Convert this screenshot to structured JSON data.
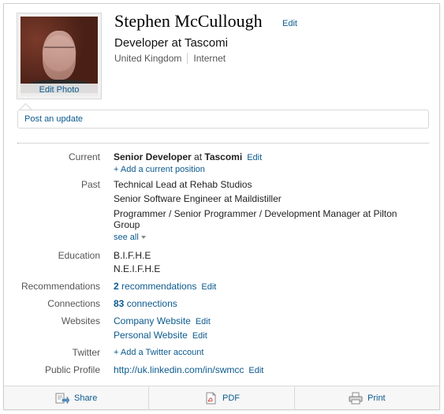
{
  "profile": {
    "name": "Stephen McCullough",
    "name_edit": "Edit",
    "edit_photo": "Edit Photo",
    "headline": "Developer at Tascomi",
    "location": "United Kingdom",
    "industry": "Internet",
    "post_update": "Post an update"
  },
  "current": {
    "label": "Current",
    "title": "Senior Developer",
    "at": " at ",
    "company": "Tascomi",
    "edit": "Edit",
    "add": "+ Add a current position"
  },
  "past": {
    "label": "Past",
    "items": [
      "Technical Lead at Rehab Studios",
      "Senior Software Engineer at Maildistiller",
      "Programmer / Senior Programmer / Development Manager at Pilton",
      "Group"
    ],
    "see_all": "see all"
  },
  "education": {
    "label": "Education",
    "items": [
      "B.I.F.H.E",
      "N.E.I.F.H.E"
    ]
  },
  "recommendations": {
    "label": "Recommendations",
    "count": "2",
    "text": " recommendations",
    "edit": "Edit"
  },
  "connections": {
    "label": "Connections",
    "count": "83",
    "text": " connections"
  },
  "websites": {
    "label": "Websites",
    "items": [
      {
        "text": "Company Website",
        "edit": "Edit"
      },
      {
        "text": "Personal Website",
        "edit": "Edit"
      }
    ]
  },
  "twitter": {
    "label": "Twitter",
    "add": "+ Add a Twitter account"
  },
  "public_profile": {
    "label": "Public Profile",
    "url": "http://uk.linkedin.com/in/swmcc",
    "edit": "Edit"
  },
  "footer": {
    "share": "Share",
    "pdf": "PDF",
    "print": "Print"
  },
  "colors": {
    "link": "#0b5a8e",
    "label": "#555555"
  }
}
